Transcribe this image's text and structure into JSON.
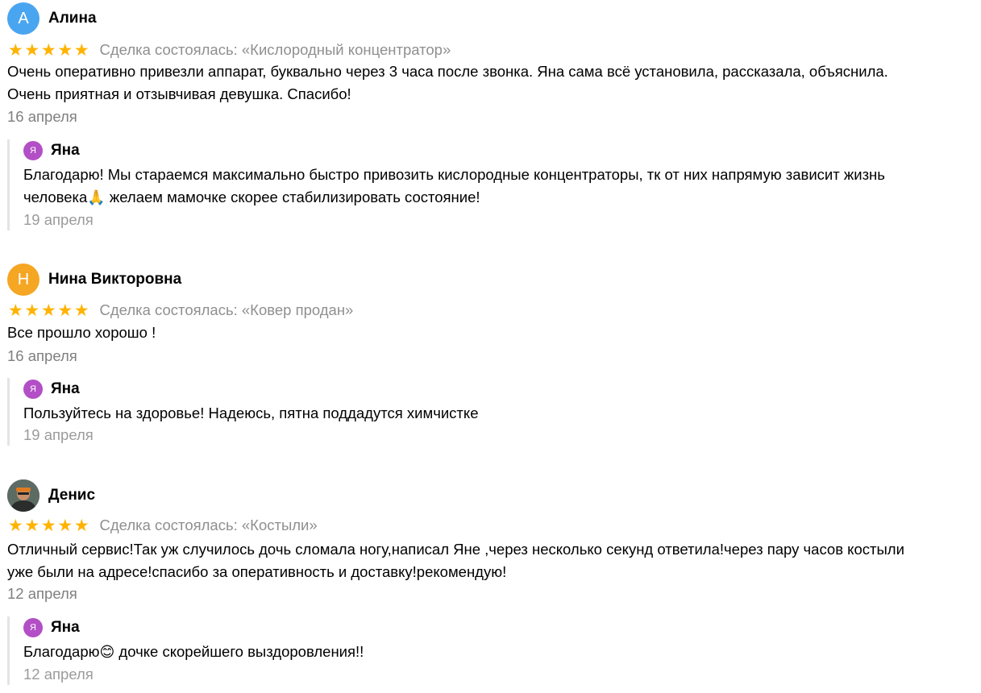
{
  "reviews": [
    {
      "avatar_letter": "А",
      "avatar_color": "#4aa5f0",
      "author": "Алина",
      "stars": [
        "★",
        "★",
        "★",
        "★",
        "★"
      ],
      "deal": "Сделка состоялась: «Кислородный концентратор»",
      "text_line1": "Очень оперативно привезли аппарат, буквально через 3 часа после звонка. Яна сама всё установила, рассказала, объяснила.",
      "text_line2": "Очень приятная и отзывчивая девушка. Спасибо!",
      "date": "16 апреля",
      "reply": {
        "avatar_letter": "Я",
        "name": "Яна",
        "line1": "Благодарю! Мы стараемся максимально быстро привозить кислородные концентраторы, тк от них напрямую зависит жизнь",
        "line2_a": "человека",
        "emoji": "🙏",
        "line2_b": " желаем мамочке скорее стабилизировать состояние!",
        "date": "19 апреля"
      }
    },
    {
      "avatar_letter": "Н",
      "avatar_color": "#f5a623",
      "author": "Нина Викторовна",
      "stars": [
        "★",
        "★",
        "★",
        "★",
        "★"
      ],
      "deal": "Сделка состоялась: «Ковер продан»",
      "text_line1": "Все прошло хорошо !",
      "date": "16 апреля",
      "reply": {
        "avatar_letter": "Я",
        "name": "Яна",
        "line1": "Пользуйтесь на здоровье! Надеюсь, пятна поддадутся химчистке",
        "date": "19 апреля"
      }
    },
    {
      "avatar_color": "#3e4a45",
      "author": "Денис",
      "stars": [
        "★",
        "★",
        "★",
        "★",
        "★"
      ],
      "deal": "Сделка состоялась: «Костыли»",
      "text_line1": "Отличный сервис!Так уж случилось дочь сломала ногу,написал Яне ,через несколько секунд ответила!через пару часов костыли",
      "text_line2": "уже были на адресе!спасибо за оперативность и доставку!рекомендую!",
      "date": "12 апреля",
      "reply": {
        "avatar_letter": "Я",
        "name": "Яна",
        "line1_a": "Благодарю",
        "emoji": "😊",
        "line1_b": " дочке скорейшего выздоровления!!",
        "date": "12 апреля"
      }
    }
  ]
}
